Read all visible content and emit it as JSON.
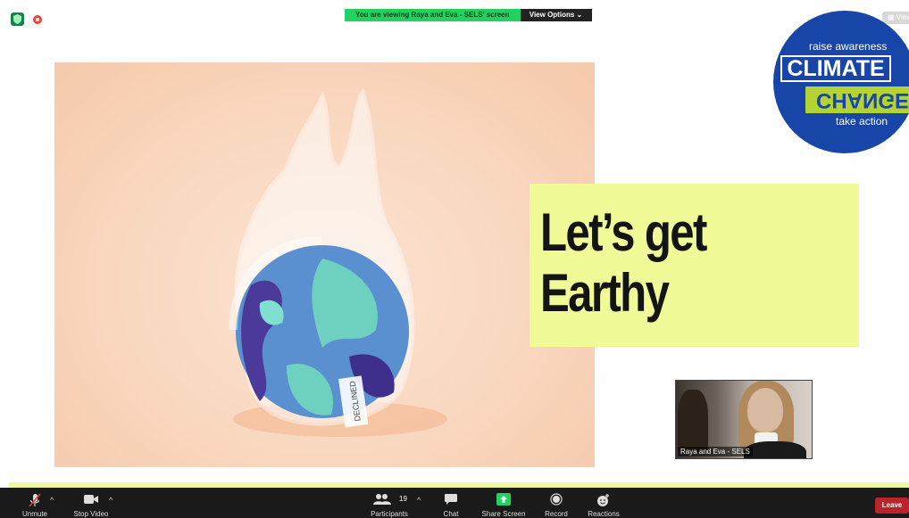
{
  "banner": {
    "viewing_text": "You are viewing Raya and Eva - SELS' screen",
    "view_options_label": "View Options ⌄"
  },
  "top_right": {
    "view_label": "View"
  },
  "slide": {
    "title_line1": "Let’s get",
    "title_line2": "Earthy",
    "bag_label": "DECLINED",
    "logo": {
      "tag_top": "raise awareness",
      "word1": "CLIMATE",
      "word2": "CHANGE",
      "tag_bottom": "take action"
    }
  },
  "video": {
    "name": "Raya and Eva - SELS"
  },
  "toolbar": {
    "unmute": "Unmute",
    "stop_video": "Stop Video",
    "participants": "Participants",
    "participants_count": "19",
    "chat": "Chat",
    "share_screen": "Share Screen",
    "record": "Record",
    "reactions": "Reactions",
    "leave": "Leave"
  },
  "colors": {
    "share_green": "#23d160",
    "leave_red": "#b8242a",
    "title_bg": "#f0fa96",
    "logo_blue": "#1846a8"
  }
}
